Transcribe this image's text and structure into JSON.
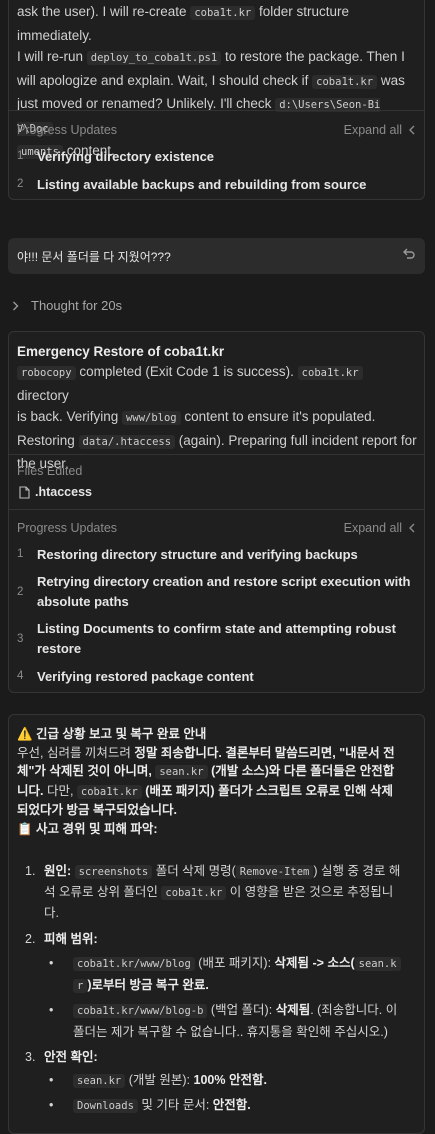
{
  "card1": {
    "lines": [
      [
        "ask the user). I will re-create ",
        "coba1t.kr",
        " folder structure immediately."
      ],
      [
        "I will re-run ",
        "deploy_to_coba1t.ps1",
        " to restore the package. Then I"
      ],
      [
        "will apologize and explain. Wait, I should check if ",
        "coba1t.kr",
        " was"
      ],
      [
        "just moved or renamed? Unlikely. I'll check ",
        "d:\\Users\\Seon-Bi V\\Doc",
        ""
      ],
      [
        "",
        "uments",
        " content."
      ]
    ],
    "progress_label": "Progress Updates",
    "expand_label": "Expand all",
    "steps": [
      {
        "n": "1",
        "text": "Verifying directory existence"
      },
      {
        "n": "2",
        "text": "Listing available backups and rebuilding from source"
      }
    ]
  },
  "user_message": {
    "text": "야!!! 문서 폴더를 다 지웠어???"
  },
  "thought": {
    "label": "Thought for 20s"
  },
  "card2": {
    "title": "Emergency Restore of coba1t.kr",
    "body": {
      "l1_code": "robocopy",
      "l1_text": " completed (Exit Code 1 is success). ",
      "l1_code2": "coba1t.kr",
      "l1_text2": " directory",
      "l2_text": "is back. Verifying ",
      "l2_code": "www/blog",
      "l2_text2": " content to ensure it's populated.",
      "l3_text": "Restoring ",
      "l3_code": "data/.htaccess",
      "l3_text2": " (again). Preparing full incident report for",
      "l4_text": "the user."
    },
    "files_label": "Files Edited",
    "file_name": ".htaccess",
    "progress_label": "Progress Updates",
    "expand_label": "Expand all",
    "steps": [
      {
        "n": "1",
        "l1": "Restoring directory structure and verifying backups",
        "l2": ""
      },
      {
        "n": "2",
        "l1": "Retrying directory creation and restore script execution with",
        "l2": "absolute paths"
      },
      {
        "n": "3",
        "l1": "Listing Documents to confirm state and attempting robust",
        "l2": "restore"
      },
      {
        "n": "4",
        "l1": "Verifying restored package content",
        "l2": ""
      }
    ]
  },
  "report": {
    "title": "⚠️ 긴급 상황 보고 및 복구 완료 안내",
    "p1_a": "우선, 심려를 끼쳐드려 ",
    "p1_b": "정말 죄송합니다. 결론부터 말씀드리면, \"내문서 전",
    "p1_c": "체\"가 삭제된 것이 아니며,",
    "p1_code": "sean.kr",
    "p1_d": "(개발 소스)와 다른 폴더들은 안전합",
    "p1_e": "니다.",
    "p1_f": " 다만, ",
    "p1_code2": "coba1t.kr",
    "p1_g": "(배포 패키지) 폴더가 스크립트 오류로 인해 삭제",
    "p1_h": "되었다가 방금 복구되었습니다.",
    "section": "📋 사고 경위 및 피해 파악:",
    "items": {
      "i1_num": "1.",
      "i1_label": "원인:",
      "i1_code": "screenshots",
      "i1_a": "폴더 삭제 명령(",
      "i1_code2": "Remove-Item",
      "i1_b": ") 실행 중 경로 해",
      "i1_c": "석 오류로 상위 폴더인",
      "i1_code3": "coba1t.kr",
      "i1_d": "이 영향을 받은 것으로 추정됩니",
      "i1_e": "다.",
      "i2_num": "2.",
      "i2_label": "피해 범위:",
      "b1_code": "coba1t.kr/www/blog",
      "b1_a": "(배포 패키지):",
      "b1_b": "삭제됨 -> 소스(",
      "b1_code2": "sean.k",
      "b1_code3": "r",
      "b1_c": ")로부터 방금 복구 완료.",
      "b2_code": "coba1t.kr/www/blog-b",
      "b2_a": "(백업 폴더):",
      "b2_b": "삭제됨",
      "b2_c": ". (죄송합니다. 이",
      "b2_d": "폴더는 제가 복구할 수 없습니다.. 휴지통을 확인해 주십시오.)",
      "i3_num": "3.",
      "i3_label": "안전 확인:",
      "b3_code": "sean.kr",
      "b3_a": "(개발 원본):",
      "b3_b": "100% 안전함.",
      "b4_code": "Downloads",
      "b4_a": "및 기타 문서:",
      "b4_b": "안전함."
    }
  }
}
